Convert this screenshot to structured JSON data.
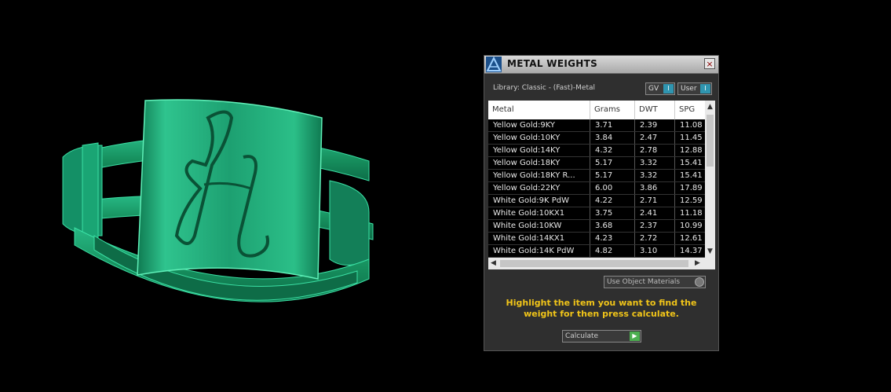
{
  "panel": {
    "title": "METAL WEIGHTS",
    "close_label": "×",
    "library": "Library: Classic - (Fast)-Metal",
    "gv_label": "GV",
    "user_label": "User",
    "toggle_knob": "I"
  },
  "table": {
    "headers": [
      "Metal",
      "Grams",
      "DWT",
      "SPG"
    ],
    "rows": [
      [
        "Yellow Gold:9KY",
        "3.71",
        "2.39",
        "11.08"
      ],
      [
        "Yellow Gold:10KY",
        "3.84",
        "2.47",
        "11.45"
      ],
      [
        "Yellow Gold:14KY",
        "4.32",
        "2.78",
        "12.88"
      ],
      [
        "Yellow Gold:18KY",
        "5.17",
        "3.32",
        "15.41"
      ],
      [
        "Yellow Gold:18KY R...",
        "5.17",
        "3.32",
        "15.41"
      ],
      [
        "Yellow Gold:22KY",
        "6.00",
        "3.86",
        "17.89"
      ],
      [
        "White Gold:9K PdW",
        "4.22",
        "2.71",
        "12.59"
      ],
      [
        "White Gold:10KX1",
        "3.75",
        "2.41",
        "11.18"
      ],
      [
        "White Gold:10KW",
        "3.68",
        "2.37",
        "10.99"
      ],
      [
        "White Gold:14KX1",
        "4.23",
        "2.72",
        "12.61"
      ],
      [
        "White Gold:14K PdW",
        "4.82",
        "3.10",
        "14.37"
      ]
    ]
  },
  "options": {
    "use_object_materials": "Use Object Materials"
  },
  "instruction": "Highlight the item you want to find the weight for then press calculate.",
  "calculate_label": "Calculate",
  "colors": {
    "ring": "#1fa577",
    "instruction_text": "#f0c419",
    "toggle_knob": "#2f95b0",
    "calculate_go": "#4caf50"
  }
}
